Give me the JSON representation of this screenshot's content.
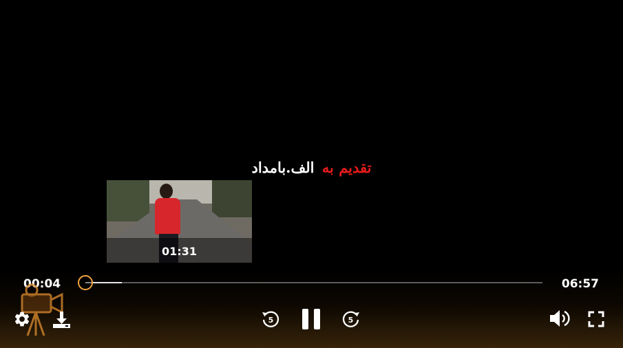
{
  "subtitle": {
    "parts": [
      {
        "text": "تقدیم به",
        "color": "#e81b1b"
      },
      {
        "text": "الف.بامداد",
        "color": "#ffffff"
      }
    ]
  },
  "preview": {
    "time": "01:31"
  },
  "playback": {
    "current_time": "00:04",
    "total_time": "06:57",
    "progress_fraction": 0.08
  },
  "colors": {
    "accent": "#f0a342",
    "text": "#ffffff"
  },
  "icons": {
    "settings": "gear-icon",
    "download": "download-icon",
    "rewind": "rewind-5-icon",
    "pause": "pause-icon",
    "forward": "forward-5-icon",
    "volume": "volume-icon",
    "fullscreen": "fullscreen-icon",
    "skip_seconds": "5"
  }
}
